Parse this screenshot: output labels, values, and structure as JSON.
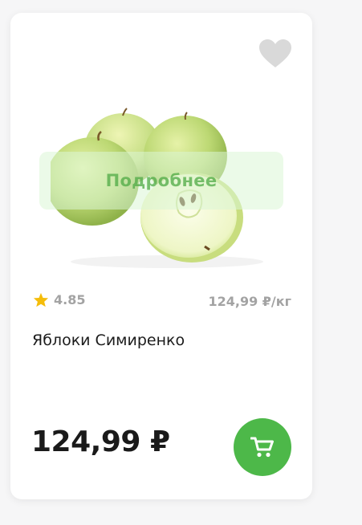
{
  "product": {
    "more_label": "Подробнее",
    "rating": "4.85",
    "unit_price": "124,99 ₽/кг",
    "title": "Яблоки Симиренко",
    "price": "124,99 ₽"
  },
  "icons": {
    "favorite": "heart-icon",
    "rating": "star-icon",
    "cart": "cart-icon"
  },
  "colors": {
    "accent": "#4db849",
    "star": "#f5bd0a",
    "heart": "#d9d9d9"
  }
}
